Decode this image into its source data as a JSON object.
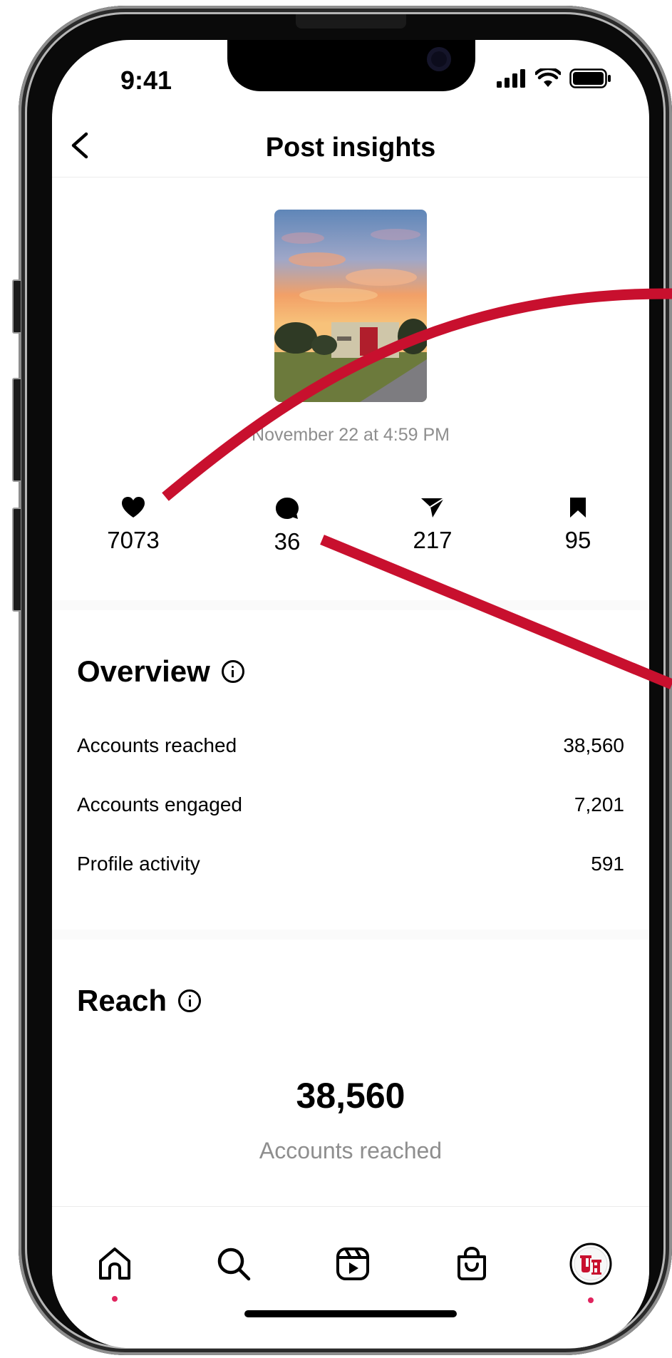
{
  "status_bar": {
    "time": "9:41"
  },
  "header": {
    "title": "Post insights"
  },
  "post": {
    "date": "November 22 at 4:59 PM"
  },
  "engagement": {
    "likes": "7073",
    "comments": "36",
    "shares": "217",
    "saves": "95"
  },
  "overview": {
    "title": "Overview",
    "rows": [
      {
        "label": "Accounts reached",
        "value": "38,560"
      },
      {
        "label": "Accounts engaged",
        "value": "7,201"
      },
      {
        "label": "Profile activity",
        "value": "591"
      }
    ]
  },
  "reach": {
    "title": "Reach",
    "value": "38,560",
    "label": "Accounts reached"
  },
  "tabbar": {
    "items": [
      "home-icon",
      "search-icon",
      "reels-icon",
      "shop-icon",
      "profile-avatar"
    ]
  },
  "colors": {
    "annotation_red": "#c8102e",
    "notification_dot": "#e0245e",
    "secondary_text": "#8e8e8e"
  }
}
